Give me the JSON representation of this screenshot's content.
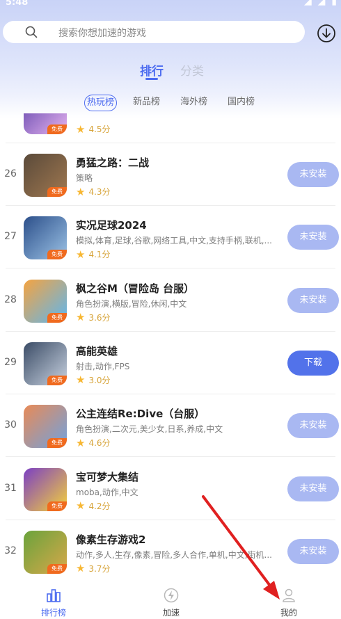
{
  "status_bar": {
    "time": "5:48"
  },
  "search": {
    "placeholder": "搜索你想加速的游戏"
  },
  "main_tabs": [
    {
      "label": "排行",
      "active": true
    },
    {
      "label": "分类",
      "active": false
    }
  ],
  "sub_tabs": [
    {
      "label": "热玩榜",
      "active": true
    },
    {
      "label": "新品榜",
      "active": false
    },
    {
      "label": "海外榜",
      "active": false
    },
    {
      "label": "国内榜",
      "active": false
    }
  ],
  "free_badge": "免费",
  "partial_row": {
    "rating": "4.5分",
    "button": ""
  },
  "games": [
    {
      "rank": "26",
      "name": "勇猛之路：二战",
      "tags": "策略",
      "rating": "4.3分",
      "button": "未安装",
      "button_type": "uninstalled",
      "thumb_colors": [
        "#5a4a3a",
        "#a07850"
      ]
    },
    {
      "rank": "27",
      "name": "实况足球2024",
      "tags": "模拟,体育,足球,谷歌,网络工具,中文,支持手柄,联机,...",
      "rating": "4.1分",
      "button": "未安装",
      "button_type": "uninstalled",
      "thumb_colors": [
        "#2c4f8a",
        "#9cc3e6"
      ]
    },
    {
      "rank": "28",
      "name": "枫之谷M（冒险岛 台服）",
      "tags": "角色扮演,横版,冒险,休闲,中文",
      "rating": "3.6分",
      "button": "未安装",
      "button_type": "uninstalled",
      "thumb_colors": [
        "#f5a340",
        "#5db6f0"
      ]
    },
    {
      "rank": "29",
      "name": "高能英雄",
      "tags": "射击,动作,FPS",
      "rating": "3.0分",
      "button": "下载",
      "button_type": "download",
      "thumb_colors": [
        "#3b4c66",
        "#c8d2e0"
      ]
    },
    {
      "rank": "30",
      "name": "公主连结Re:Dive（台服）",
      "tags": "角色扮演,二次元,美少女,日系,养成,中文",
      "rating": "4.6分",
      "button": "未安装",
      "button_type": "uninstalled",
      "thumb_colors": [
        "#e98a56",
        "#6fa2e0"
      ]
    },
    {
      "rank": "31",
      "name": "宝可梦大集结",
      "tags": "moba,动作,中文",
      "rating": "4.2分",
      "button": "未安装",
      "button_type": "uninstalled",
      "thumb_colors": [
        "#7b3fc4",
        "#f6d23a"
      ]
    },
    {
      "rank": "32",
      "name": "像素生存游戏2",
      "tags": "动作,多人,生存,像素,冒险,多人合作,单机,中文,街机...",
      "rating": "3.7分",
      "button": "未安装",
      "button_type": "uninstalled",
      "thumb_colors": [
        "#6aa33c",
        "#d8a84a"
      ]
    }
  ],
  "bottom_nav": [
    {
      "label": "排行榜",
      "icon": "ranking-icon",
      "active": true
    },
    {
      "label": "加速",
      "icon": "lightning-icon",
      "active": false
    },
    {
      "label": "我的",
      "icon": "user-icon",
      "active": false
    }
  ],
  "colors": {
    "accent": "#4d6cf0",
    "uninstalled_button": "#a9b8f2",
    "download_button": "#5272ea",
    "annotation_arrow": "#e02020"
  }
}
